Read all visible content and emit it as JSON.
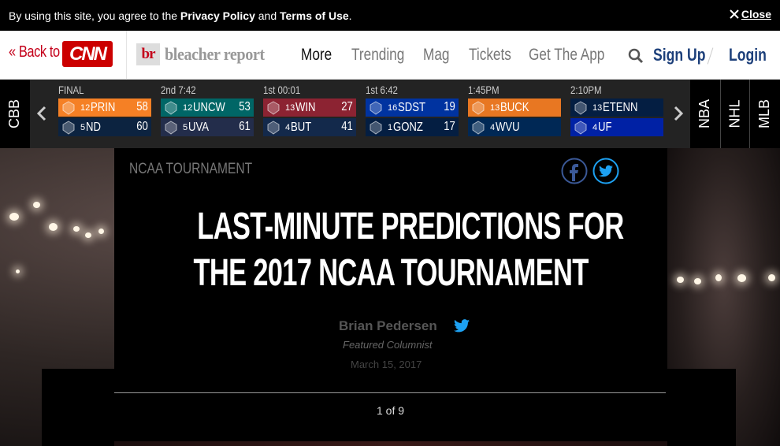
{
  "cookie": {
    "text_prefix": "By using this site, you agree to the ",
    "privacy": "Privacy Policy",
    "and": " and ",
    "terms": "Terms of Use",
    "suffix": ".",
    "close": "Close"
  },
  "nav": {
    "back": "« Back to",
    "cnn": "CNN",
    "br_mark": "br",
    "br_name": "bleacher report",
    "links": [
      "More",
      "Trending",
      "Mag",
      "Tickets",
      "Get The App"
    ],
    "signup": "Sign Up",
    "login": "Login"
  },
  "scores": {
    "left_tab": "CBB",
    "right_tabs": [
      "NBA",
      "NHL",
      "MLB"
    ],
    "games": [
      {
        "status": "FINAL",
        "teams": [
          {
            "seed": "12",
            "name": "PRIN",
            "score": "58",
            "color": "#f58025"
          },
          {
            "seed": "5",
            "name": "ND",
            "score": "60",
            "color": "#0c2340"
          }
        ]
      },
      {
        "status": "2nd 7:42",
        "teams": [
          {
            "seed": "12",
            "name": "UNCW",
            "score": "53",
            "color": "#006666"
          },
          {
            "seed": "5",
            "name": "UVA",
            "score": "61",
            "color": "#232d4b"
          }
        ]
      },
      {
        "status": "1st 00:01",
        "teams": [
          {
            "seed": "13",
            "name": "WIN",
            "score": "27",
            "color": "#8c2332"
          },
          {
            "seed": "4",
            "name": "BUT",
            "score": "41",
            "color": "#13294b"
          }
        ]
      },
      {
        "status": "1st 6:42",
        "teams": [
          {
            "seed": "16",
            "name": "SDST",
            "score": "19",
            "color": "#0033a0"
          },
          {
            "seed": "1",
            "name": "GONZ",
            "score": "17",
            "color": "#041e42"
          }
        ]
      },
      {
        "status": "1:45PM",
        "teams": [
          {
            "seed": "13",
            "name": "BUCK",
            "score": "",
            "color": "#e87722"
          },
          {
            "seed": "4",
            "name": "WVU",
            "score": "",
            "color": "#002855"
          }
        ]
      },
      {
        "status": "2:10PM",
        "teams": [
          {
            "seed": "13",
            "name": "ETENN",
            "score": "",
            "color": "#041e42"
          },
          {
            "seed": "4",
            "name": "UF",
            "score": "",
            "color": "#0021a5"
          }
        ]
      }
    ]
  },
  "article": {
    "category": "NCAA TOURNAMENT",
    "headline_line1": "LAST-MINUTE PREDICTIONS FOR",
    "headline_line2": "THE 2017 NCAA TOURNAMENT",
    "author": "Brian Pedersen",
    "role": "Featured Columnist",
    "date": "March 15, 2017",
    "pager": "1 of 9"
  },
  "colors": {
    "cnn_red": "#cc0000",
    "nav_blue": "#1c3f7a",
    "twitter_blue": "#1da1f2"
  }
}
